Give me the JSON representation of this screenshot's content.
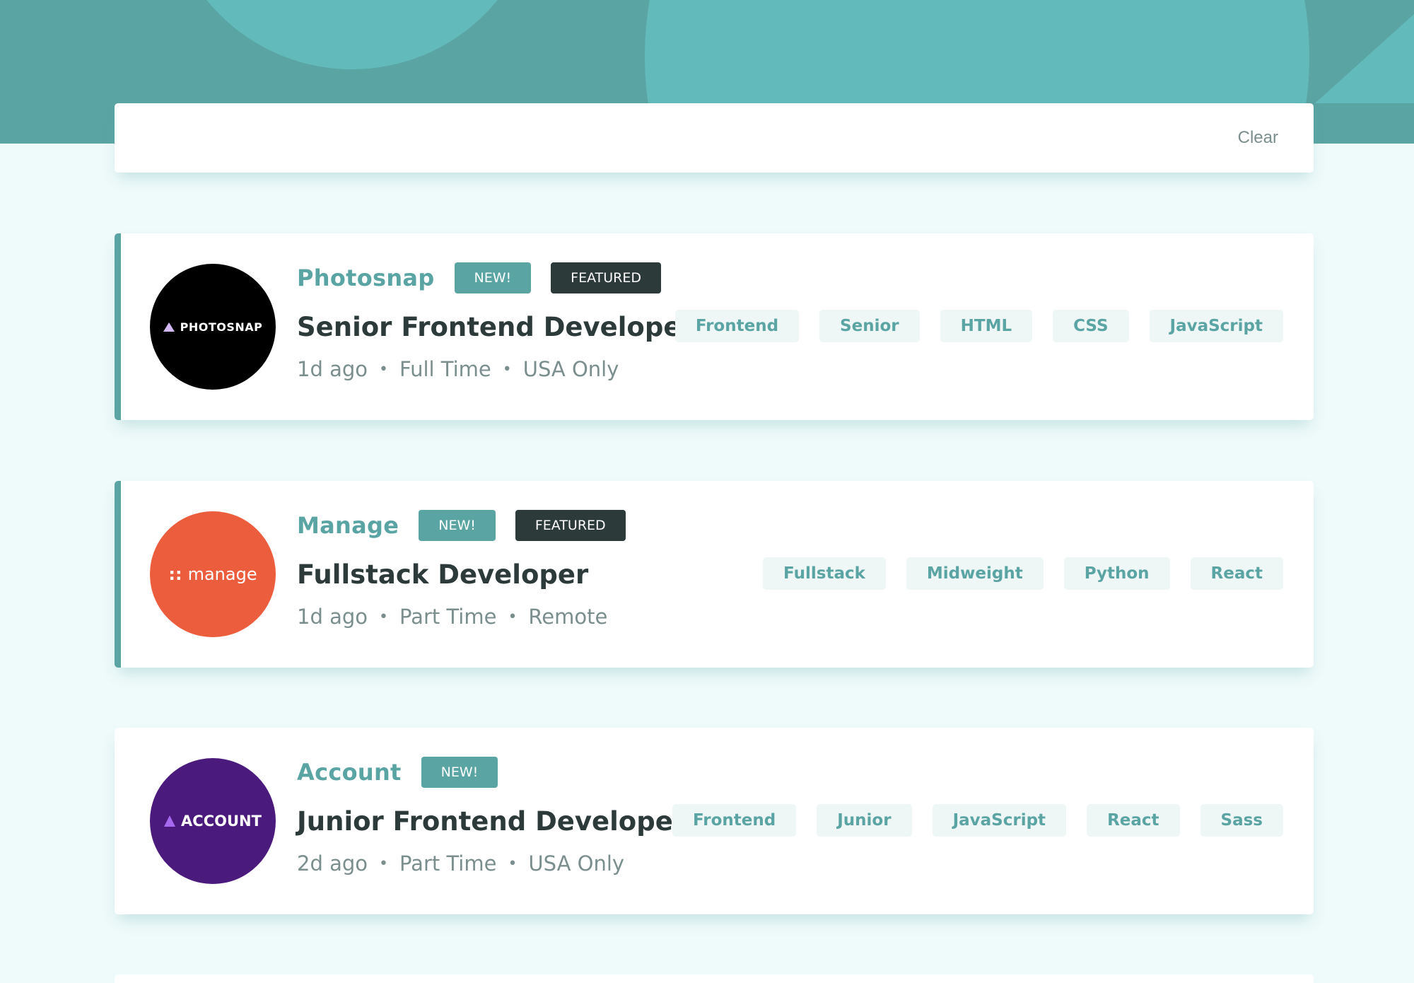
{
  "filter": {
    "clear_label": "Clear"
  },
  "jobs": [
    {
      "company": "Photosnap",
      "logo_text": "PHOTOSNAP",
      "new_label": "NEW!",
      "featured_label": "FEATURED",
      "position": "Senior Frontend Developer",
      "posted": "1d ago",
      "contract": "Full Time",
      "location": "USA Only",
      "tags": [
        "Frontend",
        "Senior",
        "HTML",
        "CSS",
        "JavaScript"
      ]
    },
    {
      "company": "Manage",
      "logo_dots": "::",
      "logo_text": "manage",
      "new_label": "NEW!",
      "featured_label": "FEATURED",
      "position": "Fullstack Developer",
      "posted": "1d ago",
      "contract": "Part Time",
      "location": "Remote",
      "tags": [
        "Fullstack",
        "Midweight",
        "Python",
        "React"
      ]
    },
    {
      "company": "Account",
      "logo_text": "ACCOUNT",
      "new_label": "NEW!",
      "position": "Junior Frontend Developer",
      "posted": "2d ago",
      "contract": "Part Time",
      "location": "USA Only",
      "tags": [
        "Frontend",
        "Junior",
        "JavaScript",
        "React",
        "Sass"
      ]
    }
  ],
  "colors": {
    "primary": "#5ba4a4",
    "dark": "#2c3a3a",
    "background": "#effafa",
    "muted": "#7b8e8e",
    "tag_bg": "#eef6f6"
  }
}
